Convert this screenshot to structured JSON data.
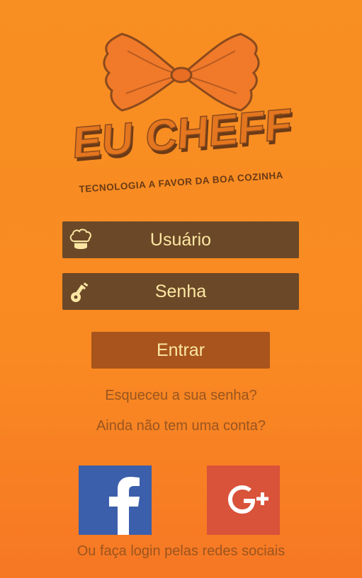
{
  "logo": {
    "brand": "EU CHEFF",
    "copyright": "©",
    "tagline": "TECNOLOGIA A FAVOR DA BOA COZINHA",
    "icon": "bowtie-pasta-icon"
  },
  "form": {
    "username_placeholder": "Usuário",
    "username_icon": "chef-hat-icon",
    "password_placeholder": "Senha",
    "password_icon": "key-icon",
    "submit_label": "Entrar"
  },
  "links": {
    "forgot_password": "Esqueceu a sua senha?",
    "no_account": "Ainda não tem uma conta?"
  },
  "social": {
    "facebook_icon": "facebook-icon",
    "google_plus_icon": "google-plus-icon",
    "caption": "Ou faça login pelas redes sociais"
  },
  "colors": {
    "background": "#f88f22",
    "field_bg": "#6b4827",
    "button_bg": "#a8541c",
    "field_text": "#fbe7a3",
    "link_text": "#9a5520",
    "facebook": "#3b5fab",
    "google_plus": "#d9523a"
  }
}
